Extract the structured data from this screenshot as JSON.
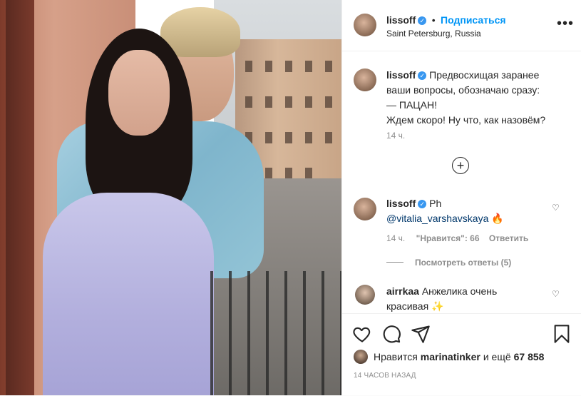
{
  "post": {
    "username": "lissoff",
    "follow_label": "Подписаться",
    "separator": "•",
    "location": "Saint Petersburg, Russia",
    "more_icon": "more-horizontal-icon",
    "photo_alt": "couple-on-balcony-photo"
  },
  "caption": {
    "username": "lissoff",
    "lines": [
      "Предвосхищая заранее",
      "ваши вопросы, обозначаю сразу:",
      "— ПАЦАН!",
      "Ждем скоро! Ну что, как назовём?"
    ],
    "time": "14 ч."
  },
  "load_more_icon": "plus-circle-icon",
  "comments": [
    {
      "username": "lissoff",
      "text": "Ph",
      "mention": "@vitalia_varshavskaya",
      "emoji": "🔥",
      "time": "14 ч.",
      "likes": "\"Нравится\": 66",
      "reply_label": "Ответить",
      "view_replies": "Посмотреть ответы (5)"
    },
    {
      "username": "airrkaa",
      "text": "Анжелика очень",
      "text2": "красивая",
      "emoji": "✨"
    }
  ],
  "actions": {
    "like_icon": "heart-icon",
    "comment_icon": "comment-icon",
    "share_icon": "share-icon",
    "save_icon": "bookmark-icon"
  },
  "likes": {
    "prefix": "Нравится",
    "user": "marinatinker",
    "suffix": "и ещё",
    "count": "67 858"
  },
  "timestamp": "14 ЧАСОВ НАЗАД"
}
